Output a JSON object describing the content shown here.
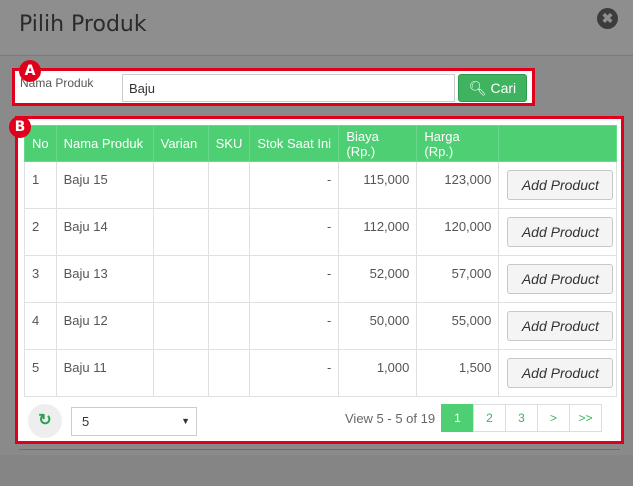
{
  "modal": {
    "title": "Pilih Produk",
    "close_icon": "✖"
  },
  "search": {
    "label": "Nama Produk",
    "value": "Baju",
    "button_label": "Cari"
  },
  "badges": {
    "a": "A",
    "b": "B"
  },
  "table": {
    "headers": [
      "No",
      "Nama Produk",
      "Varian",
      "SKU",
      "Stok Saat Ini",
      "Biaya (Rp.)",
      "Harga (Rp.)",
      ""
    ],
    "rows": [
      {
        "no": "1",
        "name": "Baju 15",
        "varian": "",
        "sku": "",
        "stok": "-",
        "biaya": "115,000",
        "harga": "123,000",
        "action": "Add Product"
      },
      {
        "no": "2",
        "name": "Baju 14",
        "varian": "",
        "sku": "",
        "stok": "-",
        "biaya": "112,000",
        "harga": "120,000",
        "action": "Add Product"
      },
      {
        "no": "3",
        "name": "Baju 13",
        "varian": "",
        "sku": "",
        "stok": "-",
        "biaya": "52,000",
        "harga": "57,000",
        "action": "Add Product"
      },
      {
        "no": "4",
        "name": "Baju 12",
        "varian": "",
        "sku": "",
        "stok": "-",
        "biaya": "50,000",
        "harga": "55,000",
        "action": "Add Product"
      },
      {
        "no": "5",
        "name": "Baju 11",
        "varian": "",
        "sku": "",
        "stok": "-",
        "biaya": "1,000",
        "harga": "1,500",
        "action": "Add Product"
      }
    ]
  },
  "footer": {
    "per_page": "5",
    "view_text": "View 5 - 5 of 19",
    "pages": [
      "1",
      "2",
      "3",
      ">",
      ">>"
    ],
    "active_page": "1"
  },
  "colors": {
    "accent": "#4fcf73",
    "highlight": "#e0001b"
  }
}
